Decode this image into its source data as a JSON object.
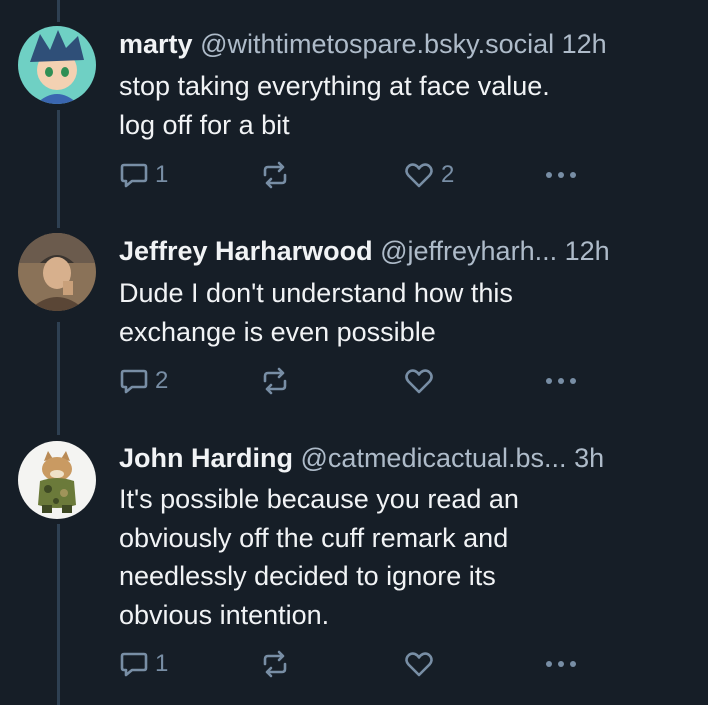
{
  "posts": [
    {
      "name": "marty",
      "handle": "@withtimetospare.bsky.social",
      "time": "12h",
      "lines": [
        "stop taking everything at face value.",
        "log off for a bit"
      ],
      "reply_count": "1",
      "repost_count": "",
      "like_count": "2"
    },
    {
      "name": "Jeffrey Harharwood",
      "handle": "@jeffreyharh...",
      "time": "12h",
      "lines": [
        "Dude I don't understand how this",
        "exchange is even possible"
      ],
      "reply_count": "2",
      "repost_count": "",
      "like_count": ""
    },
    {
      "name": "John Harding",
      "handle": "@catmedicactual.bs...",
      "time": "3h",
      "lines": [
        "It's possible because you read an",
        "obviously off the cuff remark and",
        "needlessly decided to ignore its",
        "obvious intention."
      ],
      "reply_count": "1",
      "repost_count": "",
      "like_count": ""
    }
  ],
  "icons": {
    "reply": "speech-bubble-icon",
    "repost": "repost-arrows-icon",
    "like": "heart-icon",
    "more": "ellipsis-icon"
  },
  "colors": {
    "background": "#161e27",
    "text": "#f1f3f5",
    "muted": "#aebbc9",
    "icon": "#788ea5",
    "thread_line": "#2e4052"
  }
}
